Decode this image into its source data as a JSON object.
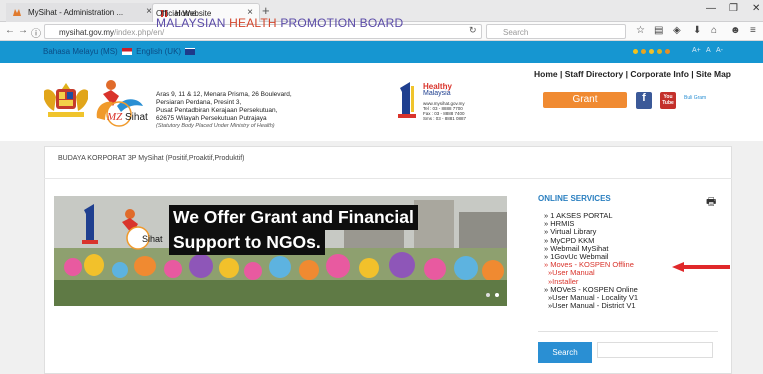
{
  "browser": {
    "tabs": [
      {
        "title": "MySihat - Administration ..."
      },
      {
        "title": "Home"
      }
    ],
    "url_host": "mysihat.gov.my",
    "url_path": "/index.php/en/",
    "search_placeholder": "Search"
  },
  "langbar": {
    "bahasa": "Bahasa Melayu (MS)",
    "english": "English (UK)",
    "font_controls": [
      "A+",
      "A",
      "A-"
    ]
  },
  "header": {
    "official": "Official Website",
    "board_prefix": "MALAYSIAN ",
    "board_highlight": "HEALTH",
    "board_suffix": " PROMOTION BOARD",
    "address": [
      "Aras 9, 11 & 12, Menara Prisma, 26 Boulevard,",
      "Persiaran Perdana, Presint 3,",
      "Pusat Pentadbiran Kerajaan Persekutuan,",
      "62675 Wilayah Persekutuan Putrajaya"
    ],
    "statutory": "(Statutory Body Placed Under Ministry of Health)",
    "logo_text": "Sihat",
    "logo_letters": "MZ",
    "healthy_title": "Healthy",
    "healthy_sub": "Malaysia",
    "healthy_details": [
      "www.mysihat.gov.my",
      "Tel : 03 - 8888 7700",
      "Fax : 03 - 8888 7400",
      "Sms : 03 - 8881 0887"
    ],
    "top_links": "Home | Staff Directory | Corporate Info | Site Map",
    "grant_label": "Grant",
    "social_labels": [
      "f",
      "You Tube",
      "Buli Gram"
    ]
  },
  "budaya": "BUDAYA KORPORAT 3P MySihat (Positif,Proaktif,Produktif)",
  "banner": {
    "line1": "We Offer Grant and Financial",
    "line2": "Support to NGOs.",
    "logo_text": "Sihat"
  },
  "online_services": {
    "title": "ONLINE SERVICES",
    "items": [
      {
        "label": "1 AKSES PORTAL",
        "style": "normal"
      },
      {
        "label": "HRMIS",
        "style": "normal"
      },
      {
        "label": "Virtual Library",
        "style": "normal"
      },
      {
        "label": "MyCPD KKM",
        "style": "normal"
      },
      {
        "label": "Webmail MySihat",
        "style": "normal"
      },
      {
        "label": "1GovUc Webmail",
        "style": "normal"
      },
      {
        "label": "Moves - KOSPEN Offline",
        "style": "red"
      },
      {
        "label": "»User Manual",
        "style": "red-sub"
      },
      {
        "label": "»Installer",
        "style": "red-sub"
      },
      {
        "label": "MOVeS - KOSPEN Online",
        "style": "normal"
      },
      {
        "label": "»User Manual - Locality V1",
        "style": "sub"
      },
      {
        "label": "»User Manual - District V1",
        "style": "sub"
      }
    ]
  },
  "search_button": "Search",
  "colors": {
    "lang_bar": "#1696d1",
    "grant": "#f08a31",
    "service_title": "#2a7fc0",
    "highlight_red": "#d9332b",
    "search_btn": "#2a8fd3"
  }
}
